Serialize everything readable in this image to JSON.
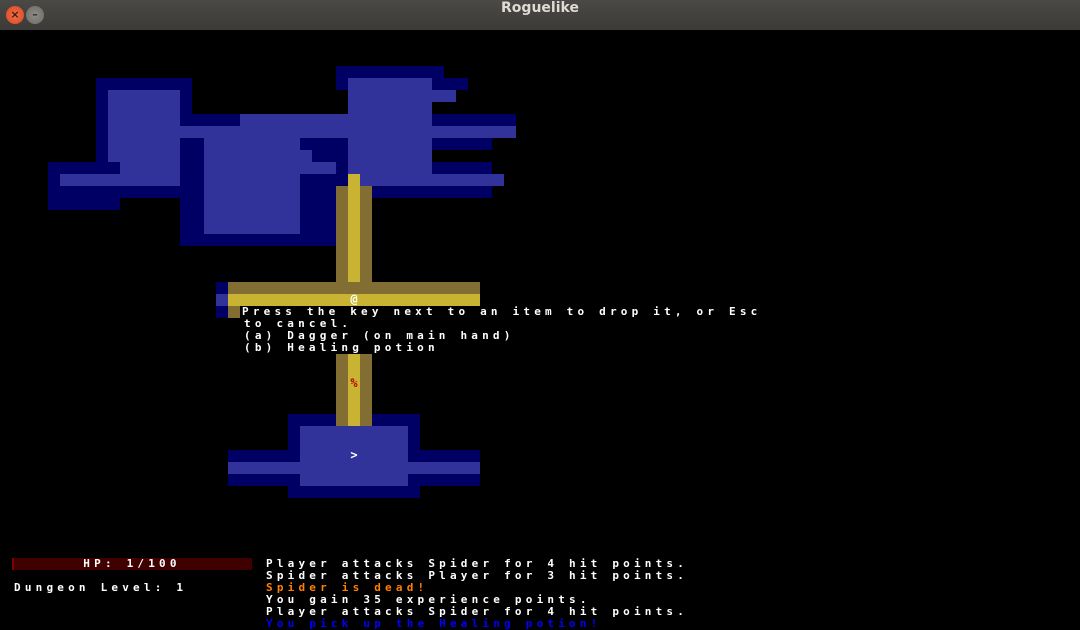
{
  "window": {
    "title": "Roguelike",
    "close_glyph": "×",
    "minimize_glyph": "–"
  },
  "map": {
    "player_glyph": "@",
    "corpse_glyph": "%",
    "stairs_glyph": ">",
    "colors": {
      "dark_wall": "#000064",
      "dark_floor": "#32329b",
      "light_wall": "#826e32",
      "light_floor": "#c8b432",
      "player": "#ffffff",
      "corpse": "#bf0000"
    }
  },
  "inventory_menu": {
    "header_line1": "Press the key next to an item to drop it, or Esc",
    "header_line2": "to cancel.",
    "items": [
      "(a) Dagger (on main hand)",
      "(b) Healing potion"
    ]
  },
  "hud": {
    "hp_text": "HP: 1/100",
    "hp_current": 1,
    "hp_max": 100,
    "dungeon_level_text": "Dungeon Level: 1"
  },
  "message_log": [
    {
      "text": "Player attacks Spider for 4 hit points.",
      "color": "#ffffff"
    },
    {
      "text": "Spider attacks Player for 3 hit points.",
      "color": "#ffffff"
    },
    {
      "text": "Spider is dead!",
      "color": "#ff7f00"
    },
    {
      "text": "You gain 35 experience points.",
      "color": "#ffffff"
    },
    {
      "text": "Player attacks Spider for 4 hit points.",
      "color": "#ffffff"
    },
    {
      "text": "You pick up the Healing potion!",
      "color": "#0000ff"
    }
  ]
}
